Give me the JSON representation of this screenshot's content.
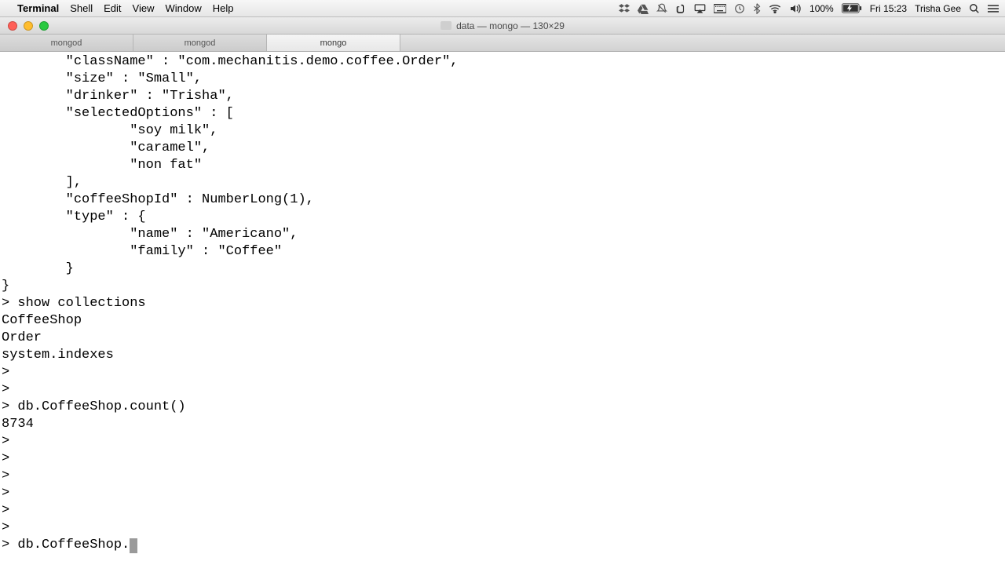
{
  "menubar": {
    "app": "Terminal",
    "items": [
      "Shell",
      "Edit",
      "View",
      "Window",
      "Help"
    ],
    "right": {
      "battery": "100%",
      "clock": "Fri 15:23",
      "user": "Trisha Gee"
    }
  },
  "window": {
    "title": "data — mongo — 130×29"
  },
  "tabs": [
    {
      "label": "mongod",
      "active": false
    },
    {
      "label": "mongod",
      "active": false
    },
    {
      "label": "mongo",
      "active": true
    }
  ],
  "terminal": {
    "lines": [
      "        \"className\" : \"com.mechanitis.demo.coffee.Order\",",
      "        \"size\" : \"Small\",",
      "        \"drinker\" : \"Trisha\",",
      "        \"selectedOptions\" : [",
      "                \"soy milk\",",
      "                \"caramel\",",
      "                \"non fat\"",
      "        ],",
      "        \"coffeeShopId\" : NumberLong(1),",
      "        \"type\" : {",
      "                \"name\" : \"Americano\",",
      "                \"family\" : \"Coffee\"",
      "        }",
      "}",
      "> show collections",
      "CoffeeShop",
      "Order",
      "system.indexes",
      ">",
      ">",
      "> db.CoffeeShop.count()",
      "8734",
      ">",
      ">",
      ">",
      ">",
      ">",
      ">"
    ],
    "current_prompt": "> db.CoffeeShop."
  }
}
